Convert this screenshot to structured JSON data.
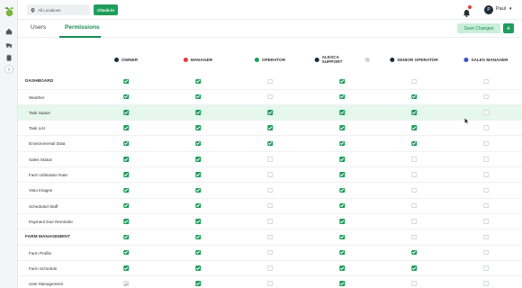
{
  "topbar": {
    "location_placeholder": "All Locations",
    "checkin_label": "Check-in",
    "user": {
      "initial": "P",
      "name": "Paul"
    }
  },
  "tabs": {
    "users": "Users",
    "permissions": "Permissions",
    "active": "Permissions"
  },
  "actions": {
    "save": "Save Changes",
    "add": "+"
  },
  "colors": {
    "accent": "#1f9d5b",
    "highlight": "#e6f7ed"
  },
  "roles": [
    {
      "label": "OWNER",
      "color": "#1d2b3a"
    },
    {
      "label": "MANAGER",
      "color": "#e53935"
    },
    {
      "label": "OPERATOR",
      "color": "#1f9d5b"
    },
    {
      "label_lines": [
        "ALESCA",
        "SUPPORT"
      ],
      "color": "#1d2b3a",
      "info_icon": "info-icon"
    },
    {
      "label": "SENIOR OPERATOR",
      "color": "#1d2b3a"
    },
    {
      "label": "SALES MANAGER",
      "color": "#3a4fd0"
    }
  ],
  "rows": [
    {
      "type": "section",
      "label": "DASHBOARD",
      "perms": [
        "on",
        "on",
        "off",
        "on",
        "off",
        "off"
      ]
    },
    {
      "type": "perm",
      "label": "Weather",
      "perms": [
        "on",
        "on",
        "off",
        "on",
        "on",
        "off"
      ]
    },
    {
      "type": "perm",
      "label": "Task Status",
      "perms": [
        "on",
        "on",
        "on",
        "on",
        "on",
        "off"
      ],
      "highlighted": true
    },
    {
      "type": "perm",
      "label": "Task List",
      "perms": [
        "on",
        "on",
        "on",
        "on",
        "on",
        "off"
      ]
    },
    {
      "type": "perm",
      "label": "Environmental Data",
      "perms": [
        "on",
        "on",
        "on",
        "on",
        "on",
        "off"
      ]
    },
    {
      "type": "perm",
      "label": "Sales Status",
      "perms": [
        "on",
        "on",
        "off",
        "on",
        "off",
        "off"
      ]
    },
    {
      "type": "perm",
      "label": "Farm Utilization Rate",
      "perms": [
        "on",
        "on",
        "off",
        "on",
        "off",
        "off"
      ]
    },
    {
      "type": "perm",
      "label": "Visio Images",
      "perms": [
        "on",
        "on",
        "off",
        "on",
        "off",
        "off"
      ]
    },
    {
      "type": "perm",
      "label": "Scheduled Staff",
      "perms": [
        "on",
        "on",
        "off",
        "on",
        "off",
        "off"
      ]
    },
    {
      "type": "perm",
      "label": "Payment Due Reminder",
      "perms": [
        "on",
        "on",
        "off",
        "on",
        "off",
        "off"
      ]
    },
    {
      "type": "section",
      "label": "FARM MANAGEMENT",
      "perms": [
        "on",
        "on",
        "off",
        "on",
        "off",
        "off"
      ]
    },
    {
      "type": "perm",
      "label": "Farm Profile",
      "perms": [
        "on",
        "on",
        "off",
        "on",
        "on",
        "off"
      ]
    },
    {
      "type": "perm",
      "label": "Farm Schedule",
      "perms": [
        "on",
        "on",
        "off",
        "on",
        "on",
        "off"
      ]
    },
    {
      "type": "perm",
      "label": "User Management",
      "perms": [
        "dis",
        "on",
        "off",
        "on",
        "off",
        "off"
      ]
    }
  ]
}
